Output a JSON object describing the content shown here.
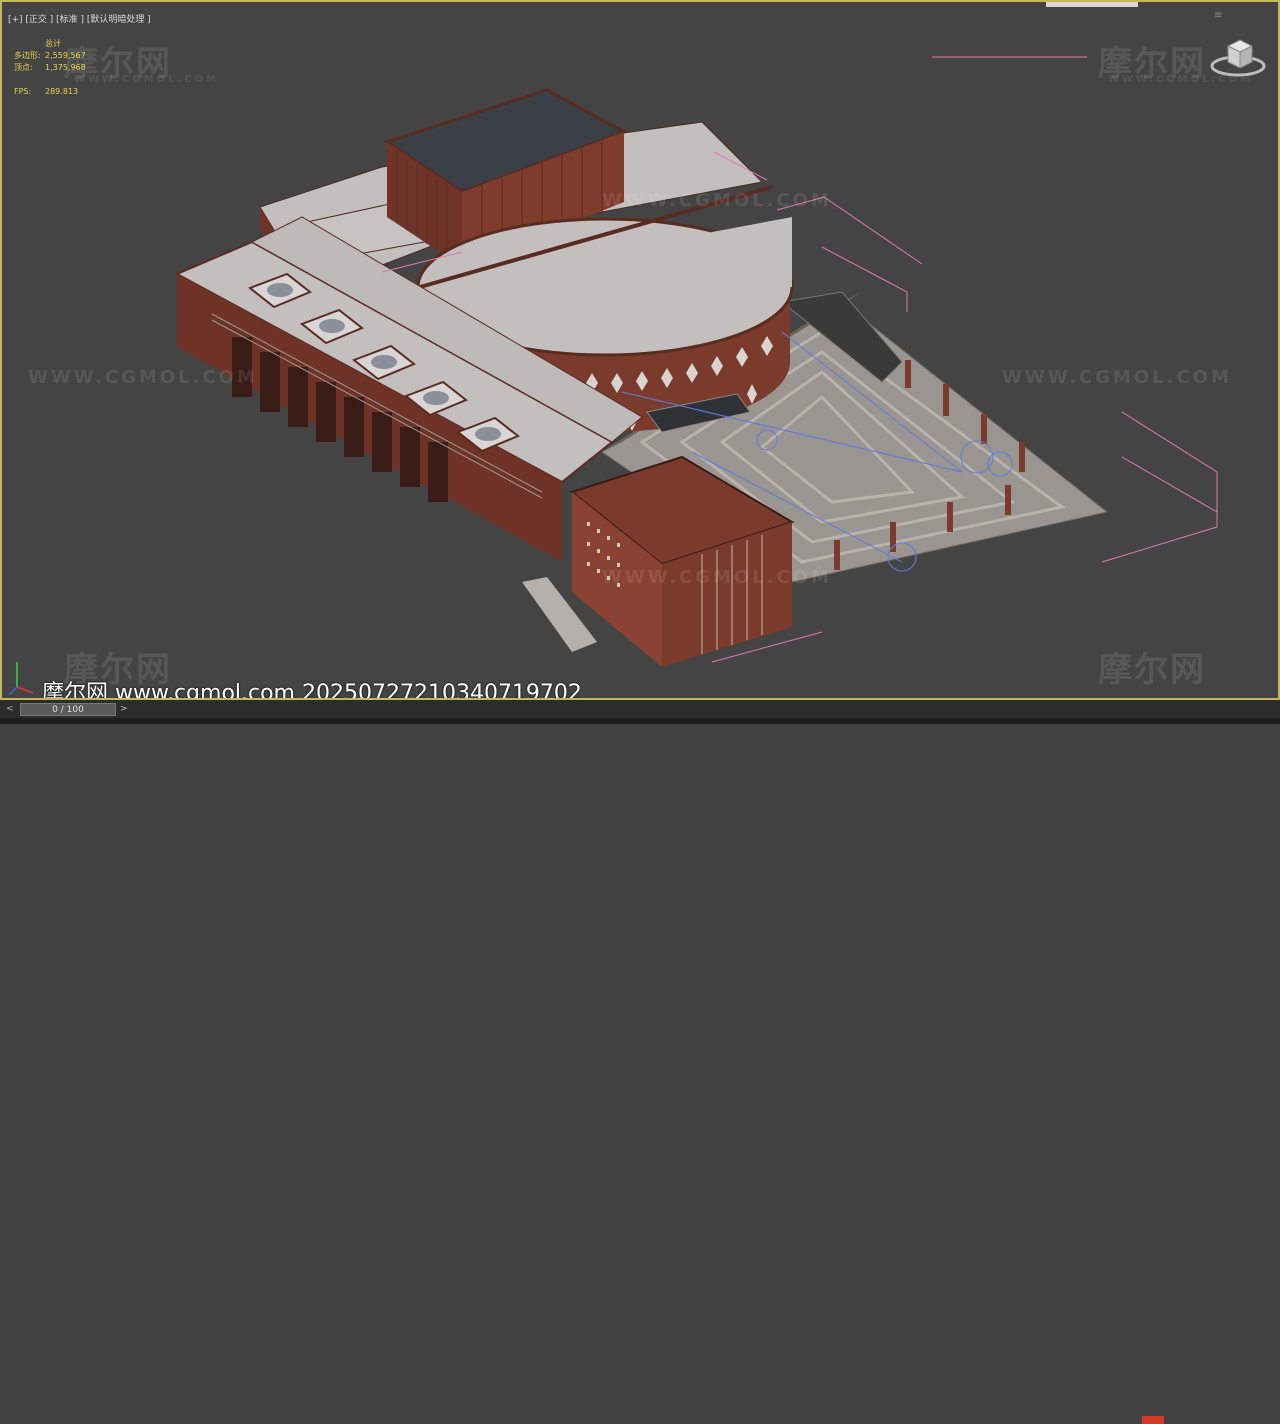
{
  "viewport": {
    "label": "[+] [正交 ] [标准 ] [默认明暗处理 ]"
  },
  "stats": {
    "total_label": "总计",
    "polygons_label": "多边形:",
    "polygons_value": "2,559,567",
    "vertices_label": "顶点:",
    "vertices_value": "1,375,968",
    "fps_label": "FPS:",
    "fps_value": "289.813"
  },
  "watermarks": {
    "brand_cn": "摩尔网",
    "brand_en": "WWW.CGMOL.COM",
    "url": "WWW.CGMOL.COM"
  },
  "credit": {
    "text": "摩尔网 www.cgmol.com 20250727210340719702"
  },
  "timeline": {
    "frame": "0 / 100",
    "left_arrow": "<",
    "right_arrow": ">"
  },
  "colors": {
    "viewport_bg": "#444444",
    "active_border": "#c8b45a",
    "stats_text": "#e6d24a",
    "brick": "#7a3a2c",
    "roof": "#c4bfbf",
    "helper_pink": "#e07ab0",
    "helper_blue": "#5a7de0"
  },
  "icons": {
    "viewcube": "viewcube-icon",
    "axis": "axis-tripod-icon"
  }
}
